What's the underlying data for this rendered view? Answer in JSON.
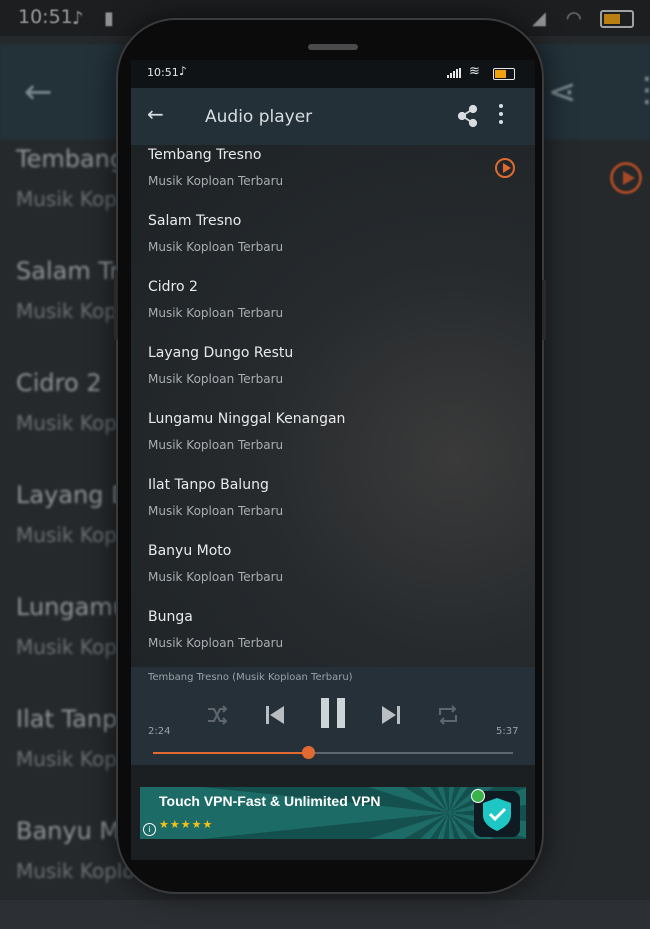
{
  "status_bar": {
    "time": "10:51"
  },
  "toolbar": {
    "title": "Audio player"
  },
  "songs": [
    {
      "title": "Tembang Tresno",
      "subtitle": "Musik Koploan Terbaru"
    },
    {
      "title": "Salam Tresno",
      "subtitle": "Musik Koploan Terbaru"
    },
    {
      "title": "Cidro 2",
      "subtitle": "Musik Koploan Terbaru"
    },
    {
      "title": "Layang Dungo Restu",
      "subtitle": "Musik Koploan Terbaru"
    },
    {
      "title": "Lungamu Ninggal Kenangan",
      "subtitle": "Musik Koploan Terbaru"
    },
    {
      "title": "Ilat Tanpo Balung",
      "subtitle": "Musik Koploan Terbaru"
    },
    {
      "title": "Banyu Moto",
      "subtitle": "Musik Koploan Terbaru"
    },
    {
      "title": "Bunga",
      "subtitle": "Musik Koploan Terbaru"
    }
  ],
  "player": {
    "now_playing": "Tembang Tresno (Musik Koploan Terbaru)",
    "current_time": "2:24",
    "total_time": "5:37",
    "progress": 0.43
  },
  "ad": {
    "title": "Touch VPN-Fast & Unlimited VPN",
    "stars": "★★★★★",
    "info_icon": "i"
  },
  "colors": {
    "accent": "#e06a32",
    "toolbar": "#233038",
    "player": "#253038"
  },
  "background_copy": {
    "time": "10:51",
    "items": [
      {
        "title": "Tembang T",
        "subtitle": "Musik Kopl"
      },
      {
        "title": "Salam Tre",
        "subtitle": "Musik Kopl"
      },
      {
        "title": "Cidro 2",
        "subtitle": "Musik Kopl"
      },
      {
        "title": "Layang Du",
        "subtitle": "Musik Kopl"
      },
      {
        "title": "Lungamu N",
        "subtitle": "Musik Kopl"
      },
      {
        "title": "Ilat Tanpo",
        "subtitle": "Musik Kopl"
      },
      {
        "title": "Banyu Moto",
        "subtitle": "Musik Koplo"
      }
    ]
  }
}
